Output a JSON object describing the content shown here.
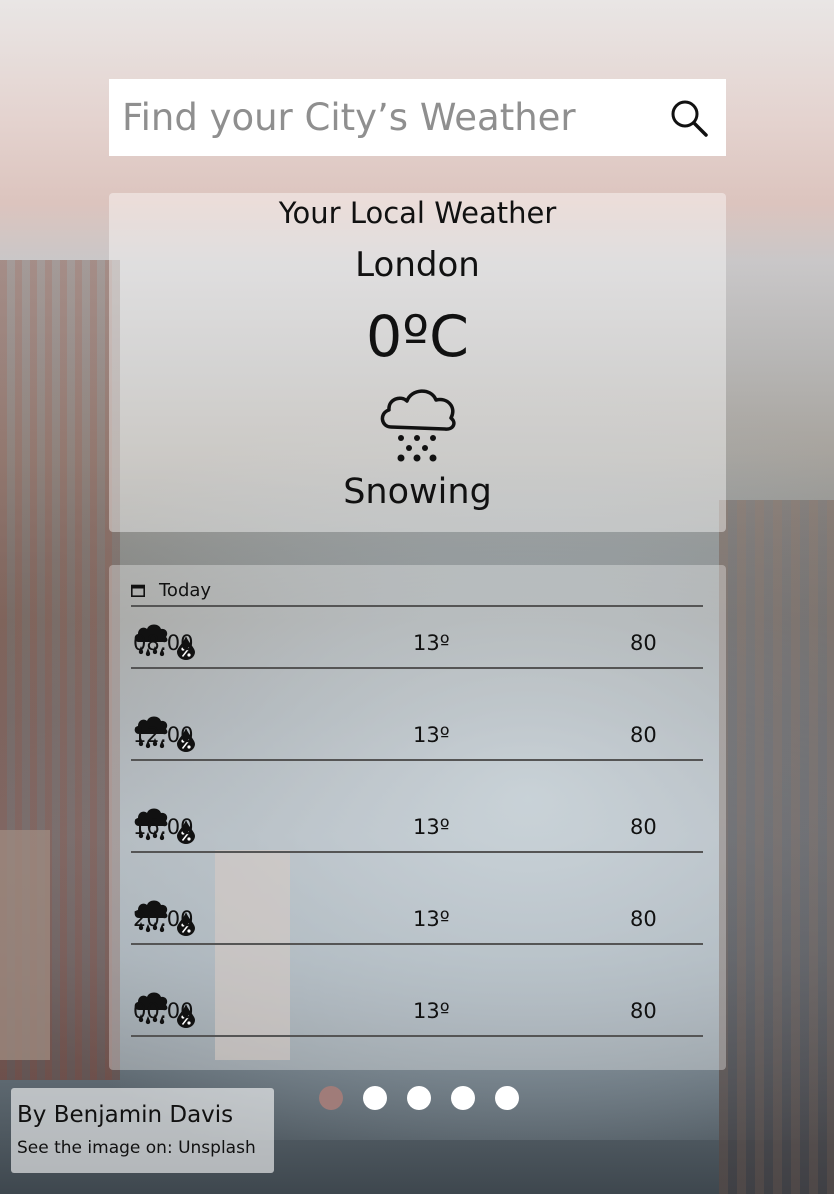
{
  "search": {
    "placeholder": "Find your City’s Weather",
    "icon": "search-icon"
  },
  "current": {
    "heading": "Your Local Weather",
    "city": "London",
    "temperature": "0ºC",
    "condition": "Snowing",
    "icon": "snow-cloud-icon"
  },
  "forecast": {
    "day_label": "Today",
    "day_icon": "calendar-icon",
    "rows": [
      {
        "time": "08:00",
        "weather_icon": "rain-cloud-icon",
        "temp": "13º",
        "humidity_icon": "humidity-drop-icon",
        "humidity": "80"
      },
      {
        "time": "12:00",
        "weather_icon": "rain-cloud-icon",
        "temp": "13º",
        "humidity_icon": "humidity-drop-icon",
        "humidity": "80"
      },
      {
        "time": "16:00",
        "weather_icon": "rain-cloud-icon",
        "temp": "13º",
        "humidity_icon": "humidity-drop-icon",
        "humidity": "80"
      },
      {
        "time": "20:00",
        "weather_icon": "rain-cloud-icon",
        "temp": "13º",
        "humidity_icon": "humidity-drop-icon",
        "humidity": "80"
      },
      {
        "time": "00:00",
        "weather_icon": "rain-cloud-icon",
        "temp": "13º",
        "humidity_icon": "humidity-drop-icon",
        "humidity": "80"
      }
    ]
  },
  "pagination": {
    "count": 5,
    "active_index": 0,
    "active_color": "#a07c79",
    "inactive_color": "#ffffff"
  },
  "credit": {
    "author": "By Benjamin Davis",
    "source_prefix": "See the image on: ",
    "source_link": "Unsplash"
  }
}
